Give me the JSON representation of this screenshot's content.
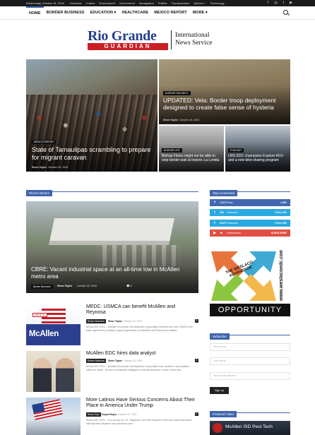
{
  "topbar": {
    "date": "Wednesday, October 31, 2018",
    "links": [
      "Overview",
      "Culture",
      "Environment",
      "Government",
      "Immigration",
      "Politics",
      "Transportation",
      "Opinion +",
      "Technology"
    ],
    "social_icons": [
      "facebook-icon",
      "instagram-icon",
      "twitter-icon",
      "youtube-icon"
    ]
  },
  "nav": {
    "items": [
      "HOME",
      "BORDER BUSINESS",
      "EDUCATION ▾",
      "HEALTHCARE",
      "MEXICO REPORT",
      "MORE ▾"
    ],
    "active": "HOME"
  },
  "logo": {
    "name": "Rio Grande",
    "subname": "GUARDIAN",
    "tagline_1": "International",
    "tagline_2": "News Service"
  },
  "hero": [
    {
      "category": "MEXICO REPORT",
      "title": "State of Tamaulipas scrambling to prepare for migrant caravan",
      "author": "Steve Taylor",
      "date": "October 30, 2018"
    },
    {
      "category": "BORDER SECURITY",
      "title": "UPDATED: Vela: Border troop deployment designed to create false sense of hysteria",
      "author": "Steve Taylor",
      "date": "October 30, 2018"
    },
    {
      "category": "BORDER LIFE",
      "title": "Bishop Flores might not be able to stop border wall at historic La Lomita"
    },
    {
      "category": "PODCAST",
      "title": "LRG EDC champions Explore RGV and a new bike-sharing program"
    }
  ],
  "recent": {
    "heading": "Recent Stories",
    "feature": {
      "title": "CBRE: Vacant industrial space at an all-time low in McAllen metro area",
      "category": "Border Business",
      "author": "Steve Taylor",
      "date": "October 30, 2018",
      "comments": "0"
    },
    "items": [
      {
        "title": "MEDC: USMCA can benefit McAllen and Reynosa",
        "category": "Border Business",
        "author": "Steve Taylor",
        "date": "October 30, 2018",
        "comments": "0",
        "excerpt": "MCALLEN, RGV – McAllen Economic Development Corporation believes the new USMCA free trade agreement provides a great opportunity for McAllen and Reynosa to attract...",
        "thumb_text": "McAllen",
        "thumb_stamp": "MADE IN"
      },
      {
        "title": "McAllen EDC hires data analyst",
        "category": "Border Business",
        "author": "Steve Taylor",
        "date": "October 30, 2018",
        "comments": "0",
        "excerpt": "MCALLEN, RGV – McAllen Economic Development Corporation has created a new position within its ranks - director of business intelligence and development. Justin Tudor has..."
      },
      {
        "title": "More Latinos Have Serious Concerns About Their Place in America Under Trump",
        "category": "News Clips",
        "author": "Deyna Reyes",
        "date": "October 30, 2018",
        "comments": "0",
        "excerpt": "MCALLEN, RGV – In a survey of U.S. Hispanics, the Pew Hispanic Trust and found that about half say their situation has worsened over..."
      }
    ]
  },
  "sidebar": {
    "stay_connected": "Stay Connected",
    "social": [
      {
        "icon": "facebook-icon",
        "glyph": "f",
        "count": "7,227",
        "label": "Fans",
        "action": "LIKE",
        "color": "#4267b2"
      },
      {
        "icon": "twitter-icon",
        "glyph": "t",
        "count": "910",
        "label": "Followers",
        "action": "FOLLOW",
        "color": "#29a9e1"
      },
      {
        "icon": "twitter-icon",
        "glyph": "t",
        "count": "6,827",
        "label": "Followers",
        "action": "FOLLOW",
        "color": "#29a9e1"
      },
      {
        "icon": "youtube-icon",
        "glyph": "▶",
        "count": "18",
        "label": "Subscribers",
        "action": "SUBSCRIBE",
        "color": "#e14e43"
      }
    ],
    "ad": {
      "brand": "THE WESLACO ADVANTAGE",
      "url": "www.weslacoedc.com",
      "slogan": "OPPORTUNITY"
    },
    "subscribe": {
      "heading": "Subscribe",
      "first_name": "First name",
      "last_name": "Last name",
      "email": "Your email address",
      "button": "Sign up"
    },
    "video": {
      "heading": "Featured Video",
      "title": "McAllen ISD Pest Tech"
    }
  }
}
